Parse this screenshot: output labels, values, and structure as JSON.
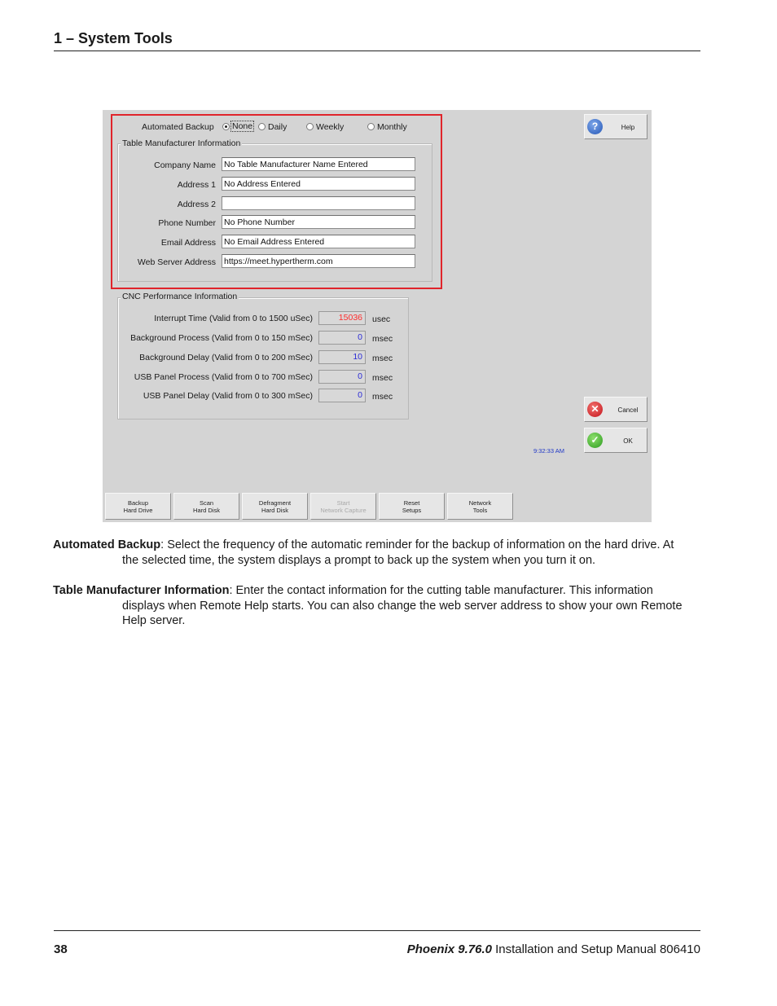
{
  "header": {
    "section_title": "1  –  System Tools"
  },
  "screen": {
    "automated_backup": {
      "label": "Automated Backup",
      "options": [
        "None",
        "Daily",
        "Weekly",
        "Monthly"
      ],
      "selected": "None"
    },
    "table_manufacturer": {
      "title": "Table Manufacturer Information",
      "fields": [
        {
          "label": "Company Name",
          "value": "No Table Manufacturer Name Entered"
        },
        {
          "label": "Address 1",
          "value": "No Address Entered"
        },
        {
          "label": "Address 2",
          "value": ""
        },
        {
          "label": "Phone Number",
          "value": "No Phone Number"
        },
        {
          "label": "Email Address",
          "value": "No Email Address Entered"
        },
        {
          "label": "Web Server Address",
          "value": "https://meet.hypertherm.com"
        }
      ]
    },
    "cnc_performance": {
      "title": "CNC Performance Information",
      "rows": [
        {
          "label": "Interrupt Time (Valid from 0 to 1500 uSec)",
          "value": "15036",
          "unit": "usec",
          "color": "#ff2b2b"
        },
        {
          "label": "Background Process (Valid from 0 to 150 mSec)",
          "value": "0",
          "unit": "msec",
          "color": "#2b2bd6"
        },
        {
          "label": "Background Delay (Valid from 0 to 200 mSec)",
          "value": "10",
          "unit": "msec",
          "color": "#2b2bd6"
        },
        {
          "label": "USB Panel Process (Valid from 0 to 700 mSec)",
          "value": "0",
          "unit": "msec",
          "color": "#2b2bd6"
        },
        {
          "label": "USB Panel Delay (Valid from 0 to 300 mSec)",
          "value": "0",
          "unit": "msec",
          "color": "#2b2bd6"
        }
      ]
    },
    "side_buttons": {
      "help": "Help",
      "cancel": "Cancel",
      "ok": "OK"
    },
    "clock": "9:32:33 AM",
    "bottom_buttons": [
      {
        "label": "Backup\nHard Drive",
        "enabled": true
      },
      {
        "label": "Scan\nHard Disk",
        "enabled": true
      },
      {
        "label": "Defragment\nHard Disk",
        "enabled": true
      },
      {
        "label": "Start\nNetwork Capture",
        "enabled": false
      },
      {
        "label": "Reset\nSetups",
        "enabled": true
      },
      {
        "label": "Network\nTools",
        "enabled": true
      }
    ],
    "highlight_color": "#e0242b"
  },
  "descriptions": {
    "automated_backup": {
      "term": "Automated Backup",
      "line1": ": Select the frequency of the automatic reminder for the backup of information on the  hard drive. At",
      "line2": "the selected time, the system displays a prompt to back up the system when you turn it on."
    },
    "table_manufacturer": {
      "term": "Table Manufacturer Information",
      "line1": ": Enter the contact information for the cutting table manufacturer. This information",
      "line2": "displays when Remote Help starts. You can also change the web server address to show your own Remote",
      "line3": "Help server."
    }
  },
  "footer": {
    "page_number": "38",
    "product": "Phoenix 9.76.0",
    "manual_title": "Installation and Setup Manual",
    "part_number": "806410"
  }
}
